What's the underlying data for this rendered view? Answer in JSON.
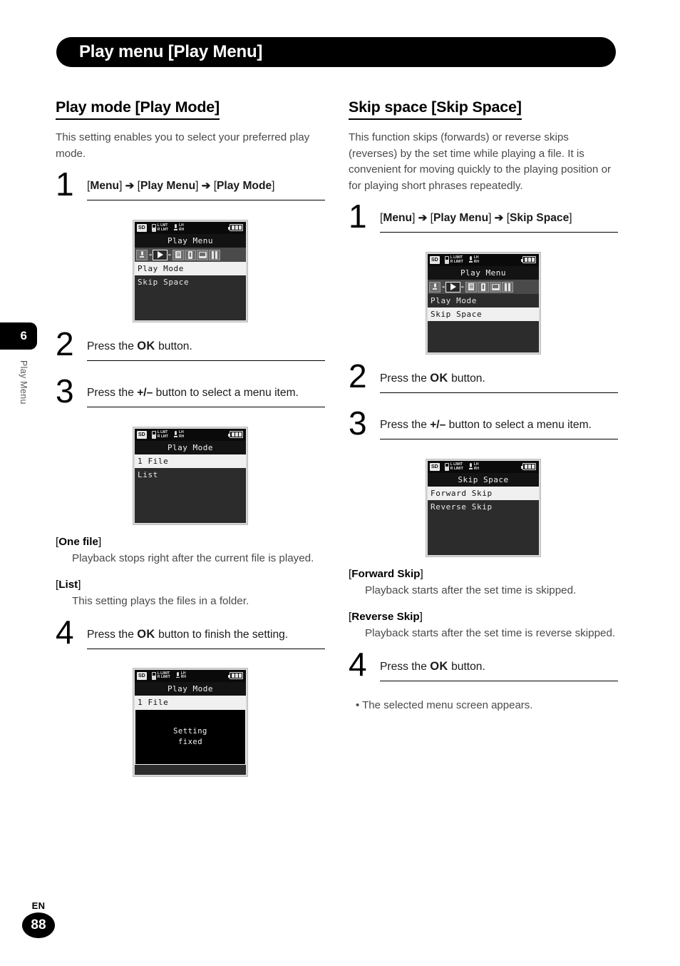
{
  "header": {
    "title": "Play menu [Play Menu]"
  },
  "side_tab": {
    "chapter_number": "6",
    "chapter_label": "Play Menu"
  },
  "footer": {
    "language": "EN",
    "page_number": "88"
  },
  "left_column": {
    "heading": "Play mode [Play Mode]",
    "intro": "This setting enables you to select your preferred play mode.",
    "steps": [
      {
        "number": "1",
        "html": "[<b>Menu</b>] <span class=\"arrow\">➔</span> [<b>Play Menu</b>] <span class=\"arrow\">➔</span> [<b>Play Mode</b>]"
      },
      {
        "number": "2",
        "html": "Press the <span class=\"ok\">OK</span> button."
      },
      {
        "number": "3",
        "html": "Press the <b>+/–</b> button to select a menu item."
      },
      {
        "number": "4",
        "html": "Press the <span class=\"ok\">OK</span> button to finish the setting."
      }
    ],
    "screen_1": {
      "status_sd": "SD",
      "status_lmt_top": "L LMT",
      "status_lmt_bottom": "R LMT",
      "status_h_top": "LH",
      "status_h_bottom": "RH",
      "title": "Play Menu",
      "rows": [
        {
          "label": "Play Mode",
          "highlighted": true
        },
        {
          "label": "Skip Space",
          "highlighted": false
        }
      ]
    },
    "screen_2": {
      "status_sd": "SD",
      "status_lmt_top": "L LMT",
      "status_lmt_bottom": "R LMT",
      "status_h_top": "LH",
      "status_h_bottom": "RH",
      "title": "Play Mode",
      "rows": [
        {
          "label": "1 File",
          "highlighted": true
        },
        {
          "label": "List",
          "highlighted": false
        }
      ]
    },
    "screen_3": {
      "status_sd": "SD",
      "status_lmt_top": "L LIMIT",
      "status_lmt_bottom": "R LIMIT",
      "status_h_top": "LH",
      "status_h_bottom": "RH",
      "title": "Play Mode",
      "rows": [
        {
          "label": "1 File",
          "highlighted": true
        }
      ],
      "message_line1": "Setting",
      "message_line2": "fixed"
    },
    "definitions": [
      {
        "term_html": "[<b>One file</b>]",
        "desc": "Playback stops right after the current file is played."
      },
      {
        "term_html": "[<b>List</b>]",
        "desc": "This setting plays the files in a folder."
      }
    ]
  },
  "right_column": {
    "heading": "Skip space [Skip Space]",
    "intro": "This function skips (forwards) or reverse skips (reverses) by the set time while playing a file. It is convenient for moving quickly to the playing position or for playing short phrases repeatedly.",
    "steps": [
      {
        "number": "1",
        "html": "[<b>Menu</b>] <span class=\"arrow\">➔</span> [<b>Play Menu</b>] <span class=\"arrow\">➔</span> [<b>Skip Space</b>]"
      },
      {
        "number": "2",
        "html": "Press the <span class=\"ok\">OK</span> button."
      },
      {
        "number": "3",
        "html": "Press the <b>+/–</b> button to select a menu item."
      },
      {
        "number": "4",
        "html": "Press the <span class=\"ok\">OK</span> button."
      }
    ],
    "screen_1": {
      "status_sd": "SD",
      "status_lmt_top": "L LIMIT",
      "status_lmt_bottom": "R LIMIT",
      "status_h_top": "LH",
      "status_h_bottom": "RH",
      "title": "Play Menu",
      "rows": [
        {
          "label": "Play Mode",
          "highlighted": false
        },
        {
          "label": "Skip Space",
          "highlighted": true
        }
      ]
    },
    "screen_2": {
      "status_sd": "SD",
      "status_lmt_top": "L LIMIT",
      "status_lmt_bottom": "R LIMIT",
      "status_h_top": "LH",
      "status_h_bottom": "RH",
      "title": "Skip Space",
      "rows": [
        {
          "label": "Forward Skip",
          "highlighted": true
        },
        {
          "label": "Reverse Skip",
          "highlighted": false
        }
      ]
    },
    "definitions": [
      {
        "term_html": "[<b>Forward Skip</b>]",
        "desc": "Playback starts after the set time is skipped."
      },
      {
        "term_html": "[<b>Reverse Skip</b>]",
        "desc": "Playback starts after the set time is reverse skipped."
      }
    ],
    "bullet_note": "• The selected menu screen appears."
  }
}
